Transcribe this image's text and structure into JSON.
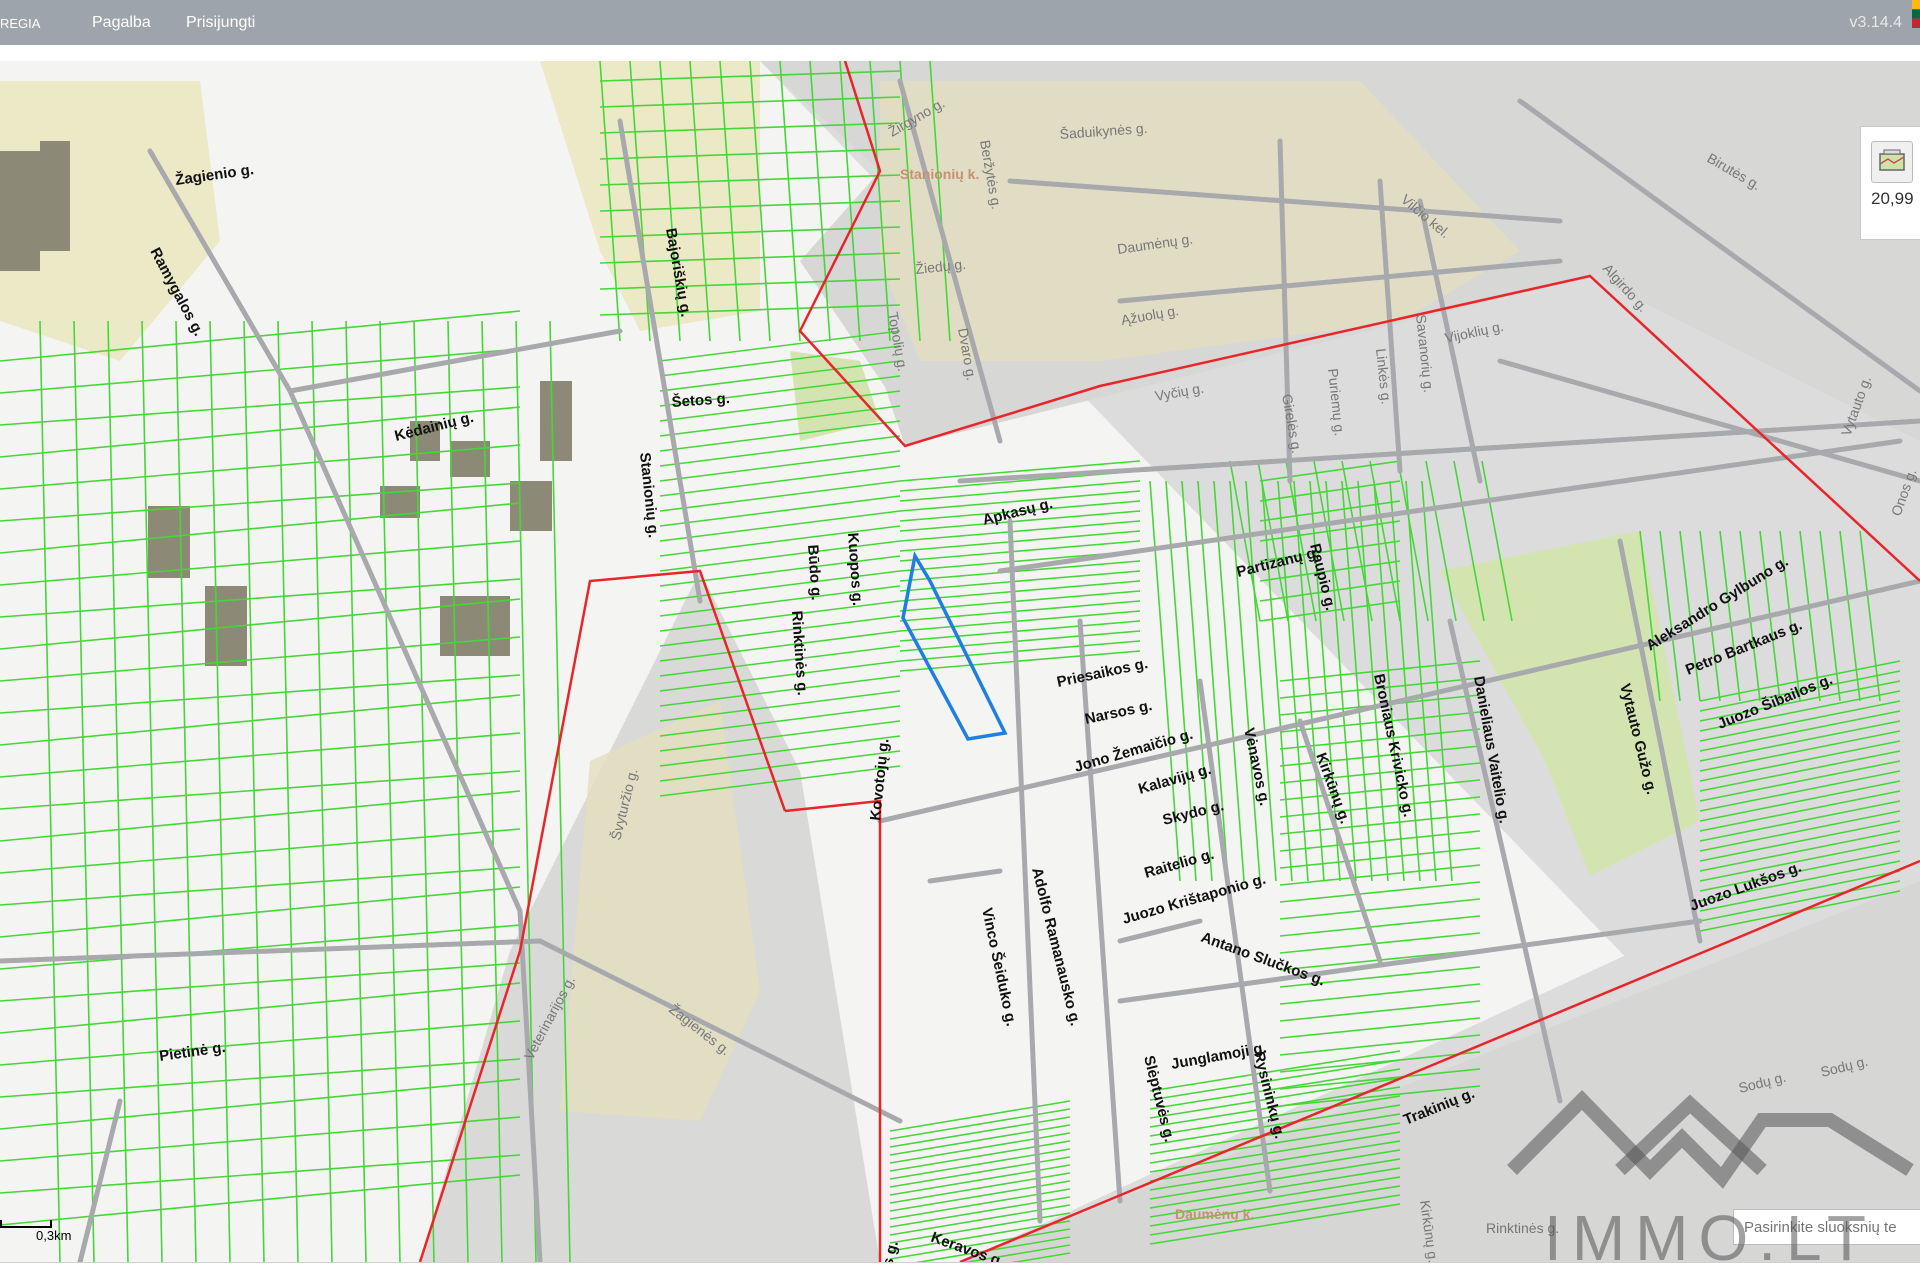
{
  "header": {
    "brand": "REGIA",
    "nav": [
      {
        "label": "Pagalba"
      },
      {
        "label": "Prisijungti"
      }
    ],
    "version": "v3.14.4"
  },
  "map": {
    "places": [
      {
        "name": "Stanionių k."
      },
      {
        "name": "Daumėnų k."
      }
    ],
    "streets": [
      "Žagienio g.",
      "Ramygalos g.",
      "Bajoriškių g.",
      "Kėdainių g.",
      "Šetos g.",
      "Stanionių g.",
      "Apkasų g.",
      "Būdo g.",
      "Kuopos g.",
      "Rinktinės g.",
      "Kovotojų g.",
      "Priesaikos g.",
      "Narsos g.",
      "Jono Žemaičio g.",
      "Kalavijų g.",
      "Skydo g.",
      "Raitelio g.",
      "Juozo Krištaponio g.",
      "Antano Slučkos g.",
      "Vinco Šeiduko g.",
      "Adolfo Ramanausko g.",
      "Junglamoji g.",
      "Slėptuvės g.",
      "Rysininkų g.",
      "Trakinių g.",
      "Keravos g.",
      "Juostos g.",
      "Veterinarijos g.",
      "Žagienės g.",
      "Švyturžio g.",
      "Pietinė g.",
      "Kirkūnų g.",
      "Partizanų g.",
      "Raupio g.",
      "Broniaus Krivicko g.",
      "Danieliaus Vaitelio g.",
      "Aleksandro Gylbuno g.",
      "Petro Bartkaus g.",
      "Juozo Šibailos g.",
      "Vytauto Gužo g.",
      "Juozo Lukšos g.",
      "Vėnavos g.",
      "Šaduikynės g.",
      "Daumėnų g.",
      "Ąžuolų g.",
      "Vyčių g.",
      "Žiedų g.",
      "Topolių g.",
      "Dvaro g.",
      "Beržytės g.",
      "Žirgyno g.",
      "Girelės g.",
      "Puriemų g.",
      "Linkės g.",
      "Savanorių g.",
      "Vijoklių g.",
      "Vilčio kel.",
      "Birutės g.",
      "Algirdo g.",
      "Vytauto g.",
      "Onos g.",
      "Sodų g.",
      "Sodų g.",
      "Kirkūnų g.",
      "Rinktinės g."
    ],
    "scale_label": "0,3km",
    "layer_value": "20,99",
    "search_placeholder": "Pasirinkite sluoksnių te"
  },
  "watermark": {
    "text": "IMMO.LT"
  },
  "colors": {
    "parcel": "#47d63a",
    "boundary": "#e8262a",
    "selected": "#1e7fe0",
    "road": "#a7a9ac",
    "urban": "#e2dfbf",
    "field": "#d4e4b0"
  }
}
